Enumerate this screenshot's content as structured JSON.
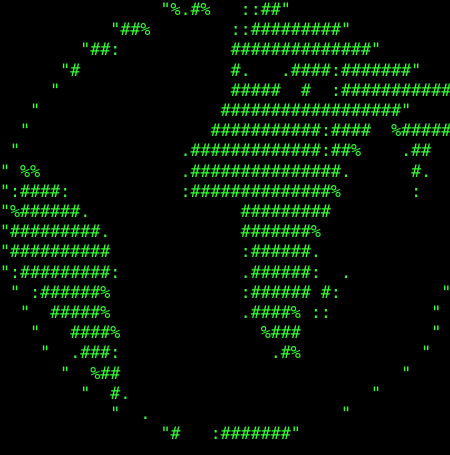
{
  "text_color": "#33ff33",
  "background_color": "#000000",
  "ascii_art": "                \"%.#%   ::##\"\n           \"##%        ::#########\"\n        \"##:           ##############\"\n      \"#               #.   .####:#######\"\n     \"                 #####  #  :###########\"\n   \"                  ##################\"\n  \"                  ###########:####  %#####\"\n \"                .#############:##%    .##  .\"\n\" %%              .###############.      #.   \"\n\":####:           :##############%       :   \"\n\"%######.               #########            \"\n\"#########.             #######%             \"\n\"##########             :######.             \"\n\":#########:            .######:  .          \"\n \" :######%             :###### #:          \"\n  \"  #####%             .####% ::          \"\n   \"   ####%              %###             \"\n    \"  .###:               .#%            \"\n      \"  %##                            \"\n        \"  #.                        \"\n           \"  .                   \"\n                \"#   :#######\""
}
